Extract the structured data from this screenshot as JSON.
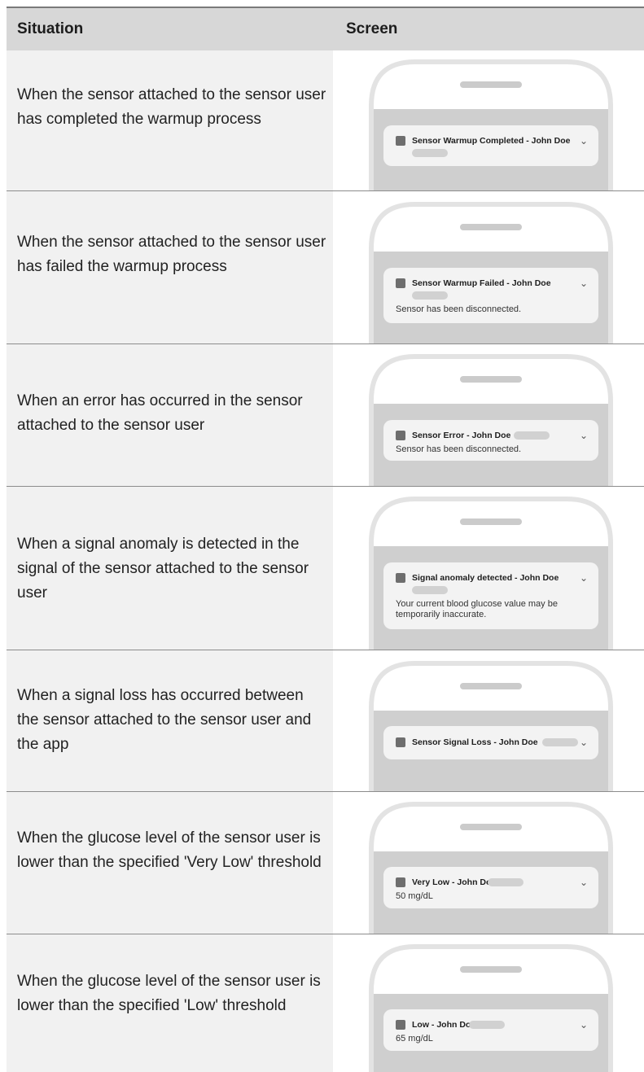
{
  "header": {
    "situation": "Situation",
    "screen": "Screen"
  },
  "rows": [
    {
      "situation": "When the sensor attached to the sensor user has completed the warmup process",
      "notification": {
        "title": "Sensor Warmup Completed - John Doe",
        "chevron": "⌄",
        "icon": "square-app-icon"
      }
    },
    {
      "situation": "When the sensor attached to the sensor user has failed the warmup process",
      "notification": {
        "title": "Sensor Warmup Failed - John Doe",
        "body": "Sensor has been disconnected.",
        "chevron": "⌄",
        "icon": "square-app-icon"
      }
    },
    {
      "situation": "When an error has occurred in the sensor attached to the sensor user",
      "notification": {
        "title": "Sensor Error - John Doe",
        "body": "Sensor has been disconnected.",
        "chevron": "⌄",
        "icon": "square-app-icon"
      }
    },
    {
      "situation": "When a signal anomaly is detected in the signal of the sensor attached to the sensor user",
      "notification": {
        "title": "Signal anomaly detected - John Doe",
        "body": "Your current blood glucose value may be temporarily inaccurate.",
        "chevron": "⌄",
        "icon": "square-app-icon"
      }
    },
    {
      "situation": "When a signal loss has occurred between the sensor attached to the sensor user and the app",
      "notification": {
        "title": "Sensor Signal Loss - John Doe",
        "chevron": "⌄",
        "icon": "square-app-icon"
      }
    },
    {
      "situation": "When the glucose level of the sensor user is lower than the specified 'Very Low' threshold",
      "notification": {
        "title": "Very Low - John Doe",
        "body": "50 mg/dL",
        "chevron": "⌄",
        "icon": "square-app-icon"
      }
    },
    {
      "situation": "When the glucose level of the sensor user is lower than the specified 'Low' threshold",
      "notification": {
        "title": "Low - John Doe",
        "body": "65 mg/dL",
        "chevron": "⌄",
        "icon": "square-app-icon"
      }
    }
  ],
  "colors": {
    "header_bg": "#d7d7d7",
    "situation_bg": "#f1f1f1",
    "phone_frame": "#e3e3e3",
    "phone_screen": "#cfcfcf",
    "notification_bg": "#f3f3f3"
  }
}
